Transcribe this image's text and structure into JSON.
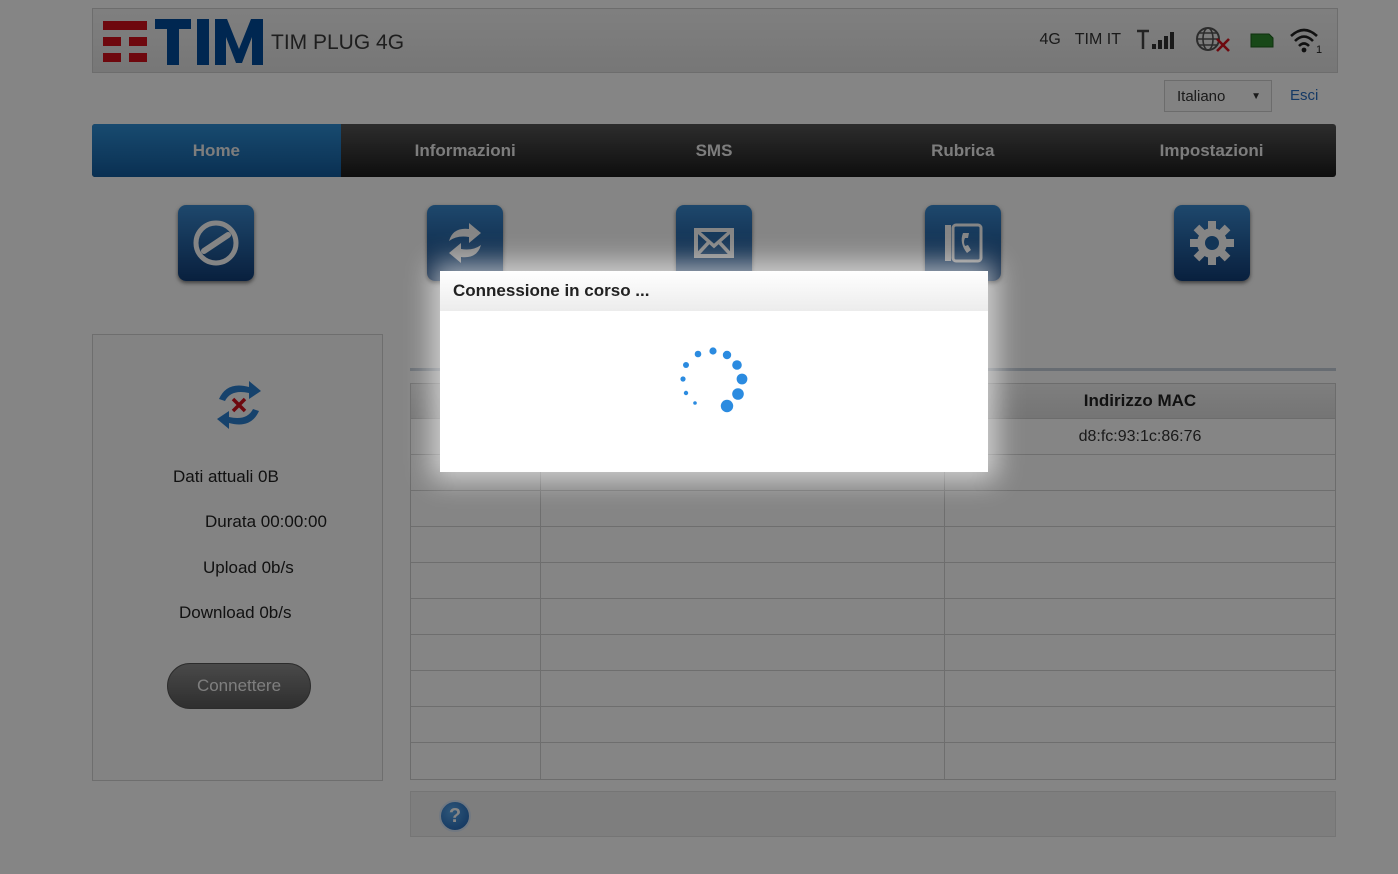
{
  "header": {
    "brand": "TIM",
    "product": "TIM PLUG 4G",
    "status": {
      "network_type": "4G",
      "operator": "TIM IT",
      "signal_icon": "signal-bars-icon",
      "internet_icon": "globe-disconnected-icon",
      "sim_icon": "sim-card-icon",
      "wifi_icon": "wifi-icon",
      "wifi_clients": "1"
    },
    "language": "Italiano",
    "logout": "Esci"
  },
  "nav": {
    "tabs": [
      {
        "label": "Home",
        "active": true
      },
      {
        "label": "Informazioni",
        "active": false
      },
      {
        "label": "SMS",
        "active": false
      },
      {
        "label": "Rubrica",
        "active": false
      },
      {
        "label": "Impostazioni",
        "active": false
      }
    ]
  },
  "quick_icons": [
    "connection-icon",
    "update-icon",
    "envelope-icon",
    "phonebook-icon",
    "gear-icon"
  ],
  "connection_panel": {
    "data": "Dati attuali 0B",
    "duration": "Durata 00:00:00",
    "upload": "Upload 0b/s",
    "download": "Download 0b/s",
    "connect_button": "Connettere"
  },
  "devices_table": {
    "column_mac": "Indirizzo MAC",
    "rows": [
      "d8:fc:93:1c:86:76",
      "",
      "",
      "",
      "",
      "",
      "",
      "",
      "",
      ""
    ]
  },
  "dialog": {
    "title": "Connessione in corso ..."
  },
  "colors": {
    "accent": "#1a6bb5",
    "brand_red": "#d4111c",
    "brand_blue": "#004b9b"
  }
}
